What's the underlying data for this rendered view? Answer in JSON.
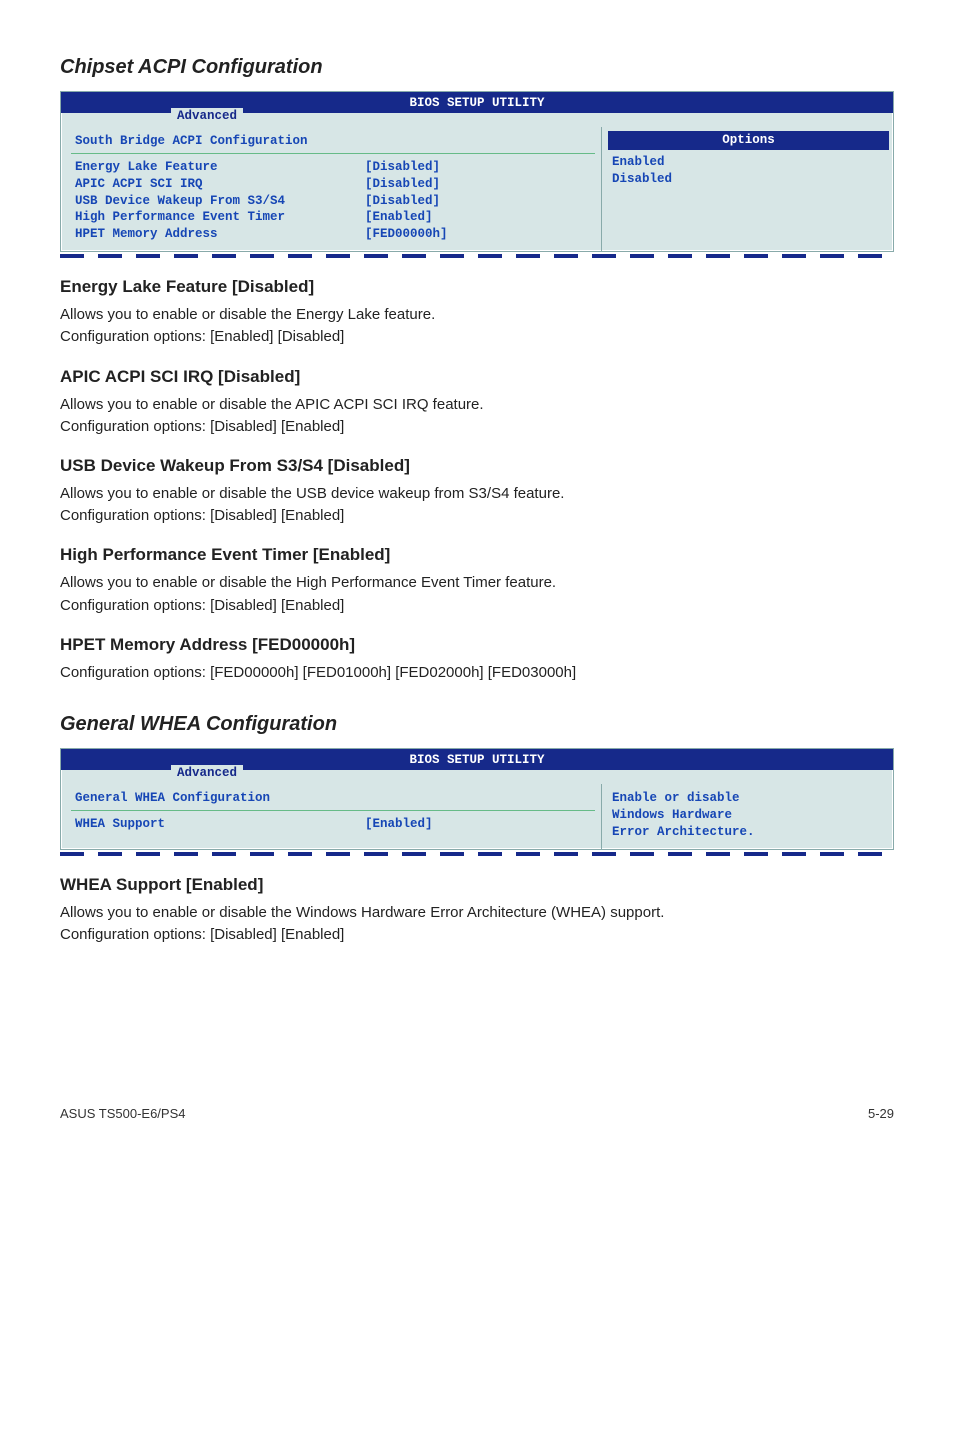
{
  "chipset": {
    "title": "Chipset ACPI Configuration",
    "bios_title": "BIOS SETUP UTILITY",
    "tab": "Advanced",
    "panel_heading": "South Bridge ACPI Configuration",
    "rows": [
      {
        "label": "Energy Lake Feature",
        "value": "[Disabled]"
      },
      {
        "label": "APIC ACPI SCI IRQ",
        "value": "[Disabled]"
      },
      {
        "label": "USB Device Wakeup From S3/S4",
        "value": "[Disabled]"
      },
      {
        "label": "High Performance Event Timer",
        "value": "[Enabled]"
      },
      {
        "label": "HPET Memory Address",
        "value": "[FED00000h]"
      }
    ],
    "options_header": "Options",
    "options": [
      "Enabled",
      "Disabled"
    ]
  },
  "sections": [
    {
      "head": "Energy Lake Feature [Disabled]",
      "lines": [
        "Allows you to enable or disable the Energy Lake feature.",
        "Configuration options: [Enabled] [Disabled]"
      ]
    },
    {
      "head": "APIC ACPI SCI IRQ [Disabled]",
      "lines": [
        "Allows you to enable or disable the APIC ACPI SCI IRQ feature.",
        "Configuration options: [Disabled] [Enabled]"
      ]
    },
    {
      "head": "USB Device Wakeup From S3/S4 [Disabled]",
      "lines": [
        "Allows you to enable or disable the USB device wakeup from S3/S4 feature.",
        "Configuration options: [Disabled] [Enabled]"
      ]
    },
    {
      "head": "High Performance Event Timer [Enabled]",
      "lines": [
        "Allows you to enable or disable the High Performance Event Timer feature.",
        "Configuration options: [Disabled] [Enabled]"
      ]
    },
    {
      "head": "HPET Memory Address [FED00000h]",
      "lines": [
        "Configuration options: [FED00000h] [FED01000h] [FED02000h] [FED03000h]"
      ]
    }
  ],
  "whea": {
    "title": "General WHEA Configuration",
    "bios_title": "BIOS SETUP UTILITY",
    "tab": "Advanced",
    "panel_heading": "General WHEA Configuration",
    "rows": [
      {
        "label": "WHEA Support",
        "value": "[Enabled]"
      }
    ],
    "help": [
      "Enable or disable",
      "Windows Hardware",
      "Error Architecture."
    ]
  },
  "whea_section": {
    "head": "WHEA Support [Enabled]",
    "lines": [
      "Allows you to enable or disable the Windows Hardware Error Architecture (WHEA) support.",
      "Configuration options: [Disabled] [Enabled]"
    ]
  },
  "footer": {
    "left": "ASUS TS500-E6/PS4",
    "right": "5-29"
  }
}
